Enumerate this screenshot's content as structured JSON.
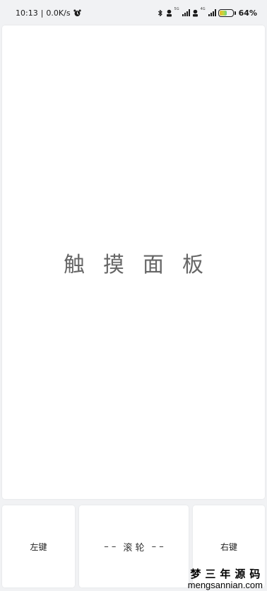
{
  "status_bar": {
    "time": "10:13",
    "network_speed": "0.0K/s",
    "separator": "|",
    "alarm_icon": "alarm-clock-icon",
    "bluetooth_icon": "bluetooth-icon",
    "sim1_tag": "5G",
    "sim2_tag": "4G",
    "battery_level": 64,
    "battery_text": "64%"
  },
  "touchpad": {
    "label": "触摸面板"
  },
  "buttons": {
    "left_label": "左键",
    "scroll_dashes_left": "– –",
    "scroll_label": "滚 轮",
    "scroll_dashes_right": "– –",
    "right_label": "右键"
  },
  "watermark": {
    "chinese": "梦三年源码",
    "domain": "mengsannian.com"
  },
  "colors": {
    "page_background": "#f1f2f4",
    "panel_background": "#ffffff",
    "touchpad_text": "#666666",
    "battery_gradient_start": "#f0b429",
    "battery_gradient_end": "#67d383"
  }
}
